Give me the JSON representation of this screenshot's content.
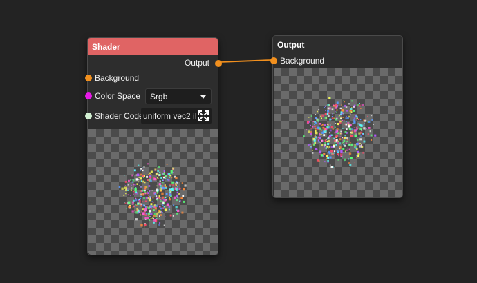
{
  "shader_node": {
    "title": "Shader",
    "output_label": "Output",
    "inputs": [
      {
        "label": "Background",
        "color": "#f2901e"
      },
      {
        "label": "Color Space",
        "color": "#e619e6"
      },
      {
        "label": "Shader Code",
        "color": "#d2f0d2"
      }
    ],
    "color_space": {
      "value": "Srgb"
    },
    "shader_code": {
      "value": "uniform vec2 iR"
    },
    "header_color": "#e06464",
    "preview_icon": "expand-icon"
  },
  "output_node": {
    "title": "Output",
    "inputs": [
      {
        "label": "Background",
        "color": "#f2901e"
      }
    ]
  },
  "connection": {
    "from": "Output",
    "to": "Background",
    "color": "#f2901e"
  }
}
